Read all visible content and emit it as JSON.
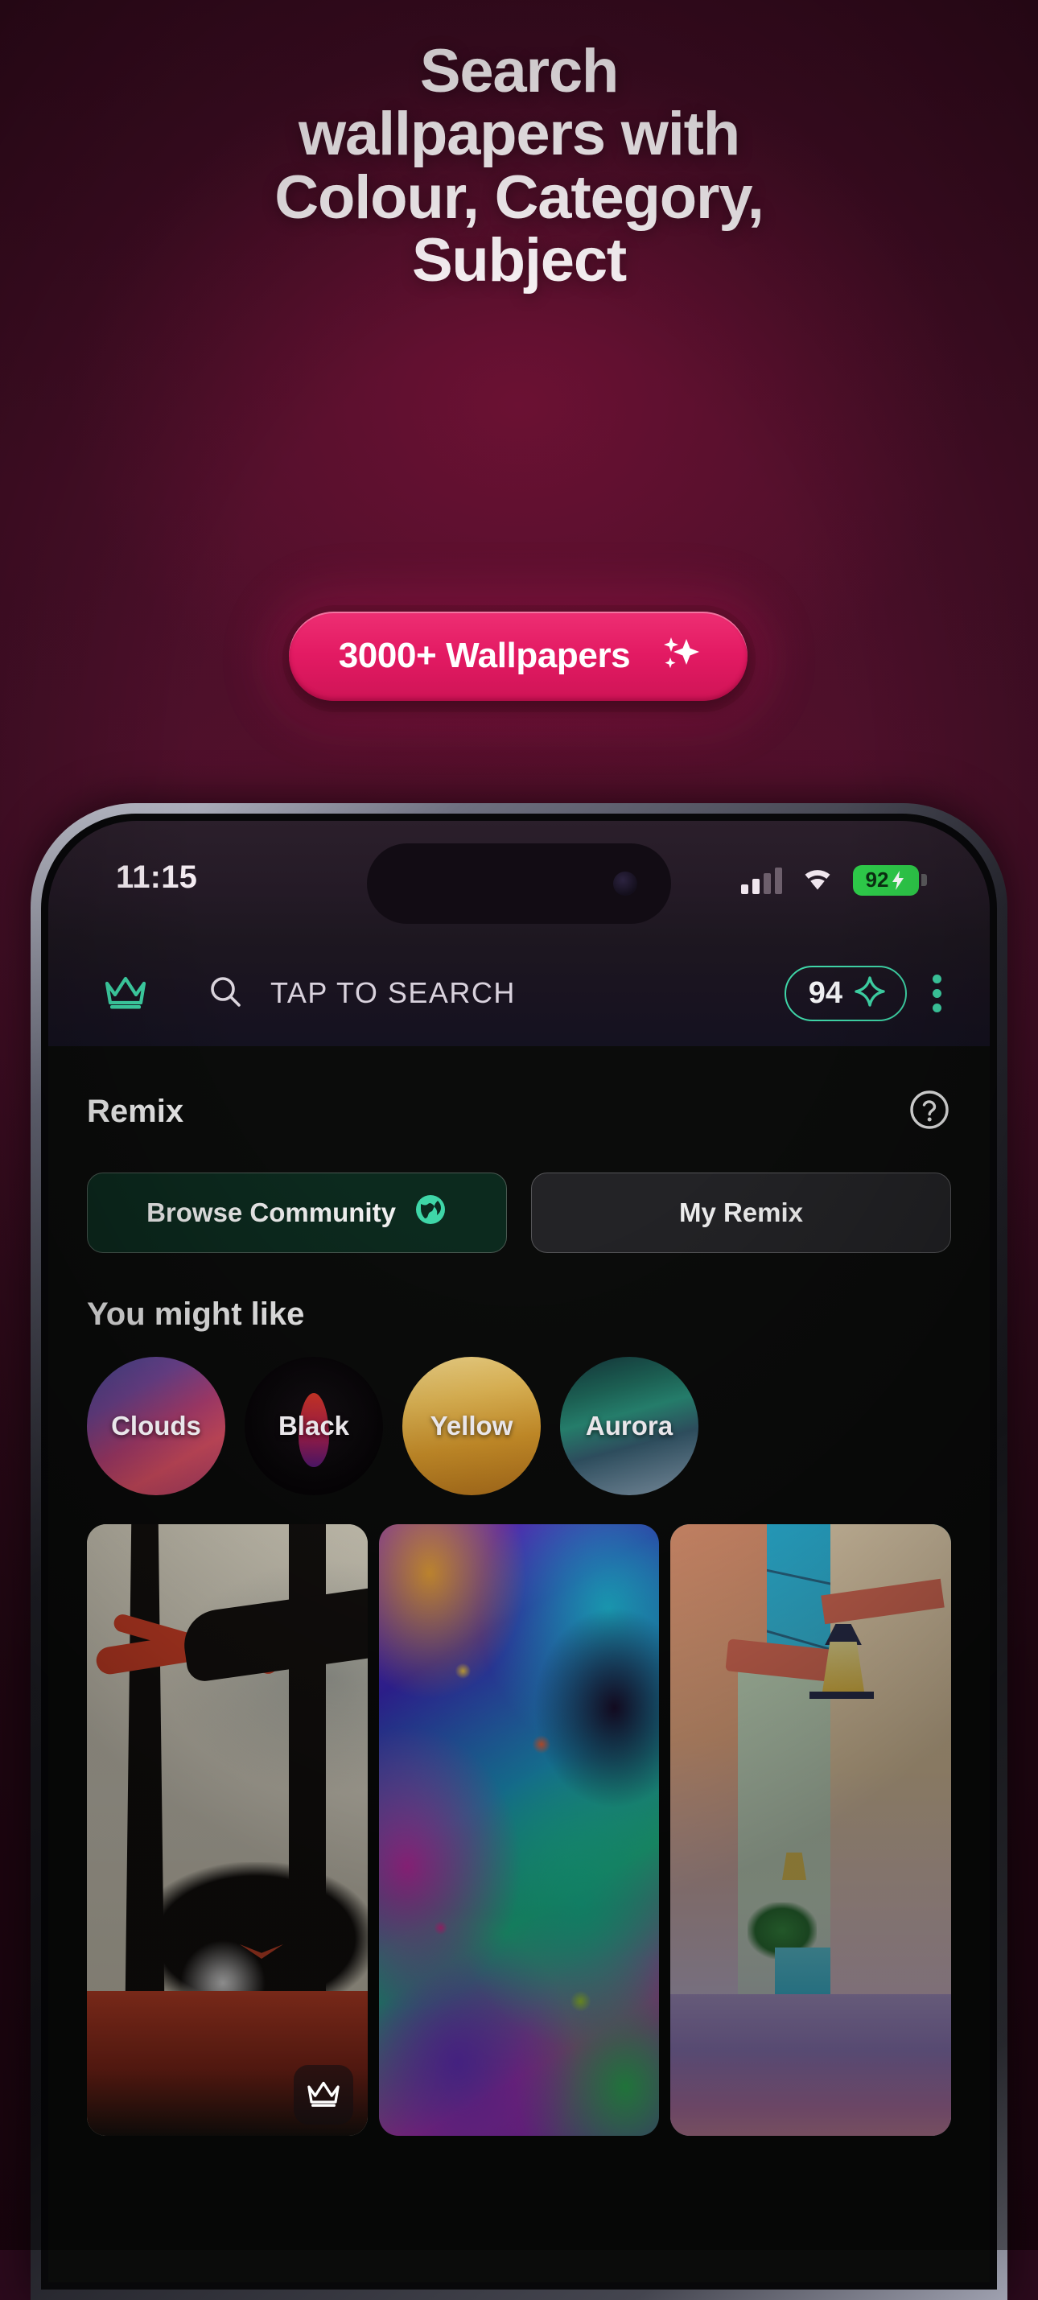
{
  "promo": {
    "headline_lines": [
      "Search",
      "wallpapers with",
      "Colour, Category,",
      "Subject"
    ],
    "badge": {
      "label": "3000+ Wallpapers",
      "icon": "sparkles-icon",
      "bg_color": "#e31a63",
      "text_color": "#ffffff"
    },
    "background_color": "#3d0c22"
  },
  "phone": {
    "status_bar": {
      "time": "11:15",
      "signal_icon": "cellular-signal-icon",
      "wifi_icon": "wifi-icon",
      "battery_percent": "92",
      "battery_charging_icon": "charging-bolt-icon",
      "battery_color": "#2ecc4a"
    },
    "app_bar": {
      "crown_icon": "crown-icon",
      "crown_color": "#3fd6a8",
      "search_icon": "search-icon",
      "search_placeholder": "TAP TO SEARCH",
      "credits_value": "94",
      "credits_icon": "sparkle-diamond-icon",
      "credits_border_color": "#3fd6a8",
      "overflow_icon": "more-vertical-icon"
    },
    "remix": {
      "title": "Remix",
      "help_icon": "help-circle-icon",
      "browse_button": {
        "label": "Browse Community",
        "icon": "globe-icon",
        "bg_color": "#0c2a1e"
      },
      "my_remix_button": {
        "label": "My Remix",
        "bg_color": "#232326"
      }
    },
    "suggestions": {
      "title": "You might like",
      "chips": [
        {
          "label": "Clouds"
        },
        {
          "label": "Black"
        },
        {
          "label": "Yellow"
        },
        {
          "label": "Aurora"
        }
      ]
    },
    "wallpapers": [
      {
        "name": "forest-lizard-wallpaper",
        "badge_icon": "crown-icon",
        "has_badge": true
      },
      {
        "name": "fluid-abstract-wallpaper",
        "has_badge": false
      },
      {
        "name": "mediterranean-street-wallpaper",
        "has_badge": false
      }
    ]
  }
}
